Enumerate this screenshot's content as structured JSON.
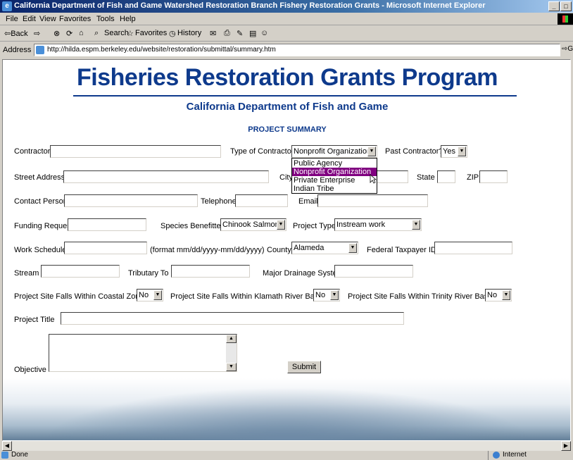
{
  "window": {
    "title": "California Department of Fish and Game Watershed Restoration Branch Fishery Restoration Grants - Microsoft Internet Explorer"
  },
  "menu": [
    "File",
    "Edit",
    "View",
    "Favorites",
    "Tools",
    "Help"
  ],
  "toolbar": {
    "back": "⇦Back",
    "forward": "⇨",
    "search": "Search",
    "favorites": "Favorites",
    "history": "History"
  },
  "address": {
    "label": "Address",
    "url": "http://hilda.espm.berkeley.edu/website/restoration/submittal/summary.htm",
    "go": "Go"
  },
  "page": {
    "title": "Fisheries Restoration Grants Program",
    "subtitle": "California Department of Fish and Game",
    "section": "PROJECT SUMMARY",
    "labels": {
      "contractor": "Contractor",
      "type_of_contractor": "Type of Contractor",
      "past_contractor": "Past Contractor?",
      "street_address": "Street Address",
      "city": "City",
      "state": "State",
      "zip": "ZIP",
      "contact_person": "Contact Person",
      "telephone": "Telephone",
      "email": "Email",
      "funding_request": "Funding Request",
      "species_benefitted": "Species Benefitted",
      "project_type": "Project Type",
      "work_schedule": "Work Schedule",
      "format_hint": "(format mm/dd/yyyy-mm/dd/yyyy)",
      "county": "County",
      "federal_taxpayer_id": "Federal Taxpayer ID",
      "stream": "Stream",
      "tributary_to": "Tributary To",
      "major_drainage": "Major Drainage System",
      "coastal_zone": "Project Site Falls Within Coastal Zone",
      "klamath": "Project Site Falls Within Klamath River Basin",
      "trinity": "Project Site Falls Within Trinity River Basin",
      "project_title": "Project Title",
      "objective": "Objective"
    },
    "selects": {
      "type_of_contractor": "Nonprofit Organization",
      "past_contractor": "Yes",
      "species_benefitted": "Chinook Salmon",
      "project_type": "Instream work",
      "county": "Alameda",
      "coastal_zone": "No",
      "klamath": "No",
      "trinity": "No"
    },
    "contractor_options": [
      "Public Agency",
      "Nonprofit Organization",
      "Private Enterprise",
      "Indian Tribe"
    ],
    "submit": "Submit"
  },
  "status": {
    "text": "Done",
    "zone": "Internet"
  },
  "colors": {
    "heading_blue": "#0e3a8c",
    "highlight": "#800080",
    "titlebar": "#0a246a"
  }
}
